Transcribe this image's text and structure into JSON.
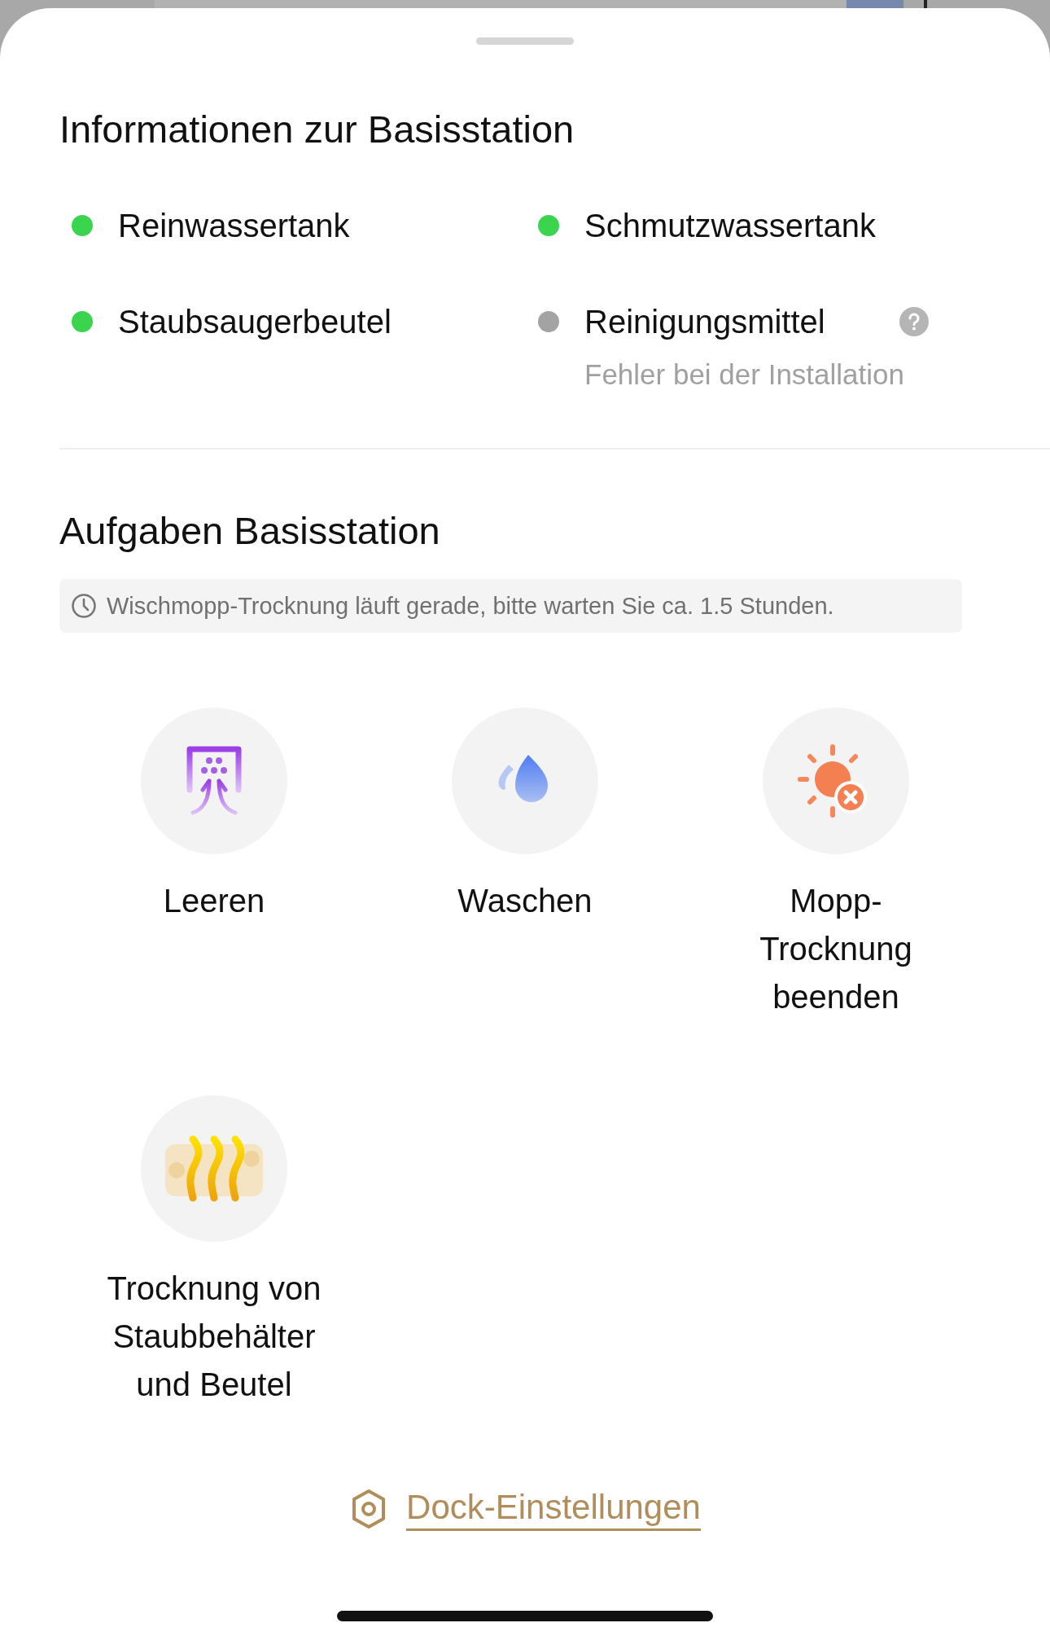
{
  "info": {
    "title": "Informationen zur Basisstation",
    "items": [
      {
        "name": "Reinwassertank",
        "color": "#3ad44f",
        "help": false
      },
      {
        "name": "Schmutzwassertank",
        "color": "#3ad44f",
        "help": false
      },
      {
        "name": "Staubsaugerbeutel",
        "color": "#3ad44f",
        "help": false
      },
      {
        "name": "Reinigungsmittel",
        "color": "#a3a3a3",
        "help": true,
        "note": "Fehler bei der Installation"
      }
    ]
  },
  "tasks": {
    "title": "Aufgaben Basisstation",
    "notice": "Wischmopp-Trocknung läuft gerade, bitte warten Sie ca. 1.5 Stunden.",
    "items": [
      {
        "label": "Leeren"
      },
      {
        "label": "Waschen"
      },
      {
        "label": "Mopp-\nTrocknung\nbeenden"
      },
      {
        "label": "Trocknung von\nStaubbehälter\nund Beutel"
      }
    ]
  },
  "link": "Dock-Einstellungen"
}
